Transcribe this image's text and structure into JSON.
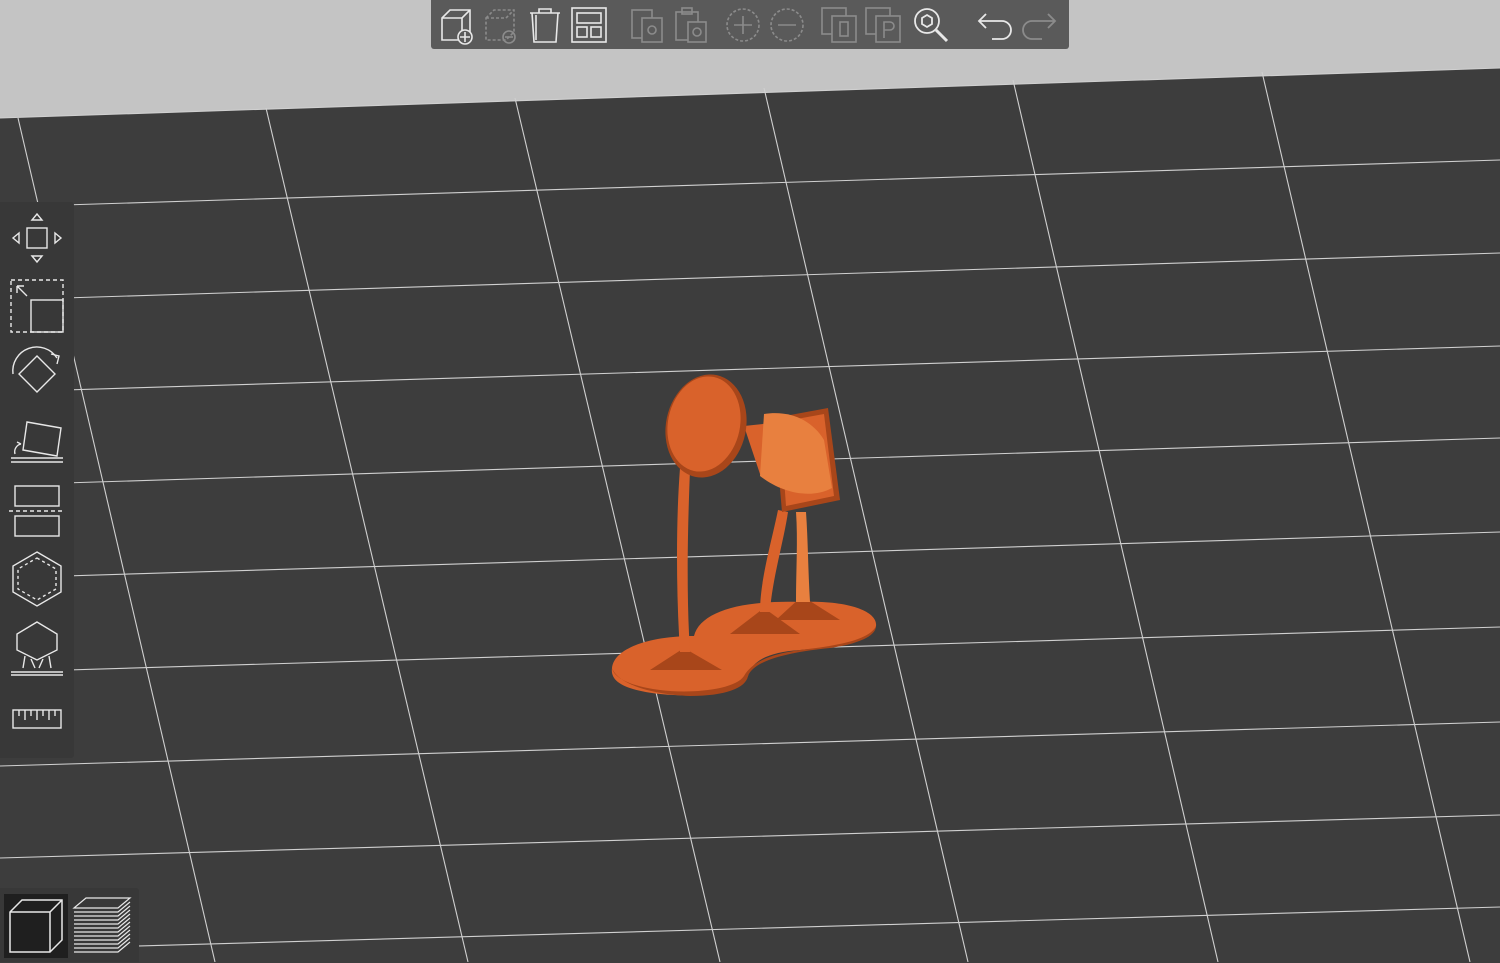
{
  "viewport": {
    "background_top_color": "#c4c4c4",
    "floor_color": "#3d3d3d",
    "grid_color": "#d0d0d0",
    "model_color": "#d9622b",
    "model_shadow_color": "#a8461a",
    "model_highlight_color": "#e8803f"
  },
  "toolbar": {
    "buttons": [
      {
        "id": "add-model",
        "icon": "cube-add-icon",
        "enabled": true
      },
      {
        "id": "remove-model",
        "icon": "cube-remove-icon",
        "enabled": false
      },
      {
        "id": "delete",
        "icon": "trash-icon",
        "enabled": true
      },
      {
        "id": "arrange",
        "icon": "arrange-layout-icon",
        "enabled": true
      },
      {
        "id": "copy",
        "icon": "copy-icon",
        "enabled": false
      },
      {
        "id": "paste",
        "icon": "paste-icon",
        "enabled": false
      },
      {
        "id": "zoom-in",
        "icon": "zoom-in-icon",
        "enabled": false
      },
      {
        "id": "zoom-out",
        "icon": "zoom-out-icon",
        "enabled": false
      },
      {
        "id": "clone-0",
        "icon": "clone-0-icon",
        "enabled": false
      },
      {
        "id": "clone-p",
        "icon": "clone-p-icon",
        "enabled": false
      },
      {
        "id": "search",
        "icon": "search-icon",
        "enabled": true
      },
      {
        "id": "undo",
        "icon": "undo-icon",
        "enabled": true
      },
      {
        "id": "redo",
        "icon": "redo-icon",
        "enabled": false
      }
    ]
  },
  "sidebar": {
    "tools": [
      {
        "id": "move",
        "icon": "move-arrows-icon"
      },
      {
        "id": "scale",
        "icon": "scale-icon"
      },
      {
        "id": "rotate",
        "icon": "rotate-icon"
      },
      {
        "id": "lay-flat",
        "icon": "lay-flat-icon"
      },
      {
        "id": "cut",
        "icon": "cut-icon"
      },
      {
        "id": "hollow",
        "icon": "hollow-icon"
      },
      {
        "id": "supports",
        "icon": "supports-icon"
      },
      {
        "id": "measure",
        "icon": "ruler-icon"
      }
    ]
  },
  "view_modes": [
    {
      "id": "3d-view",
      "icon": "solid-cube-icon",
      "active": true
    },
    {
      "id": "layer-view",
      "icon": "layers-icon",
      "active": false
    }
  ]
}
